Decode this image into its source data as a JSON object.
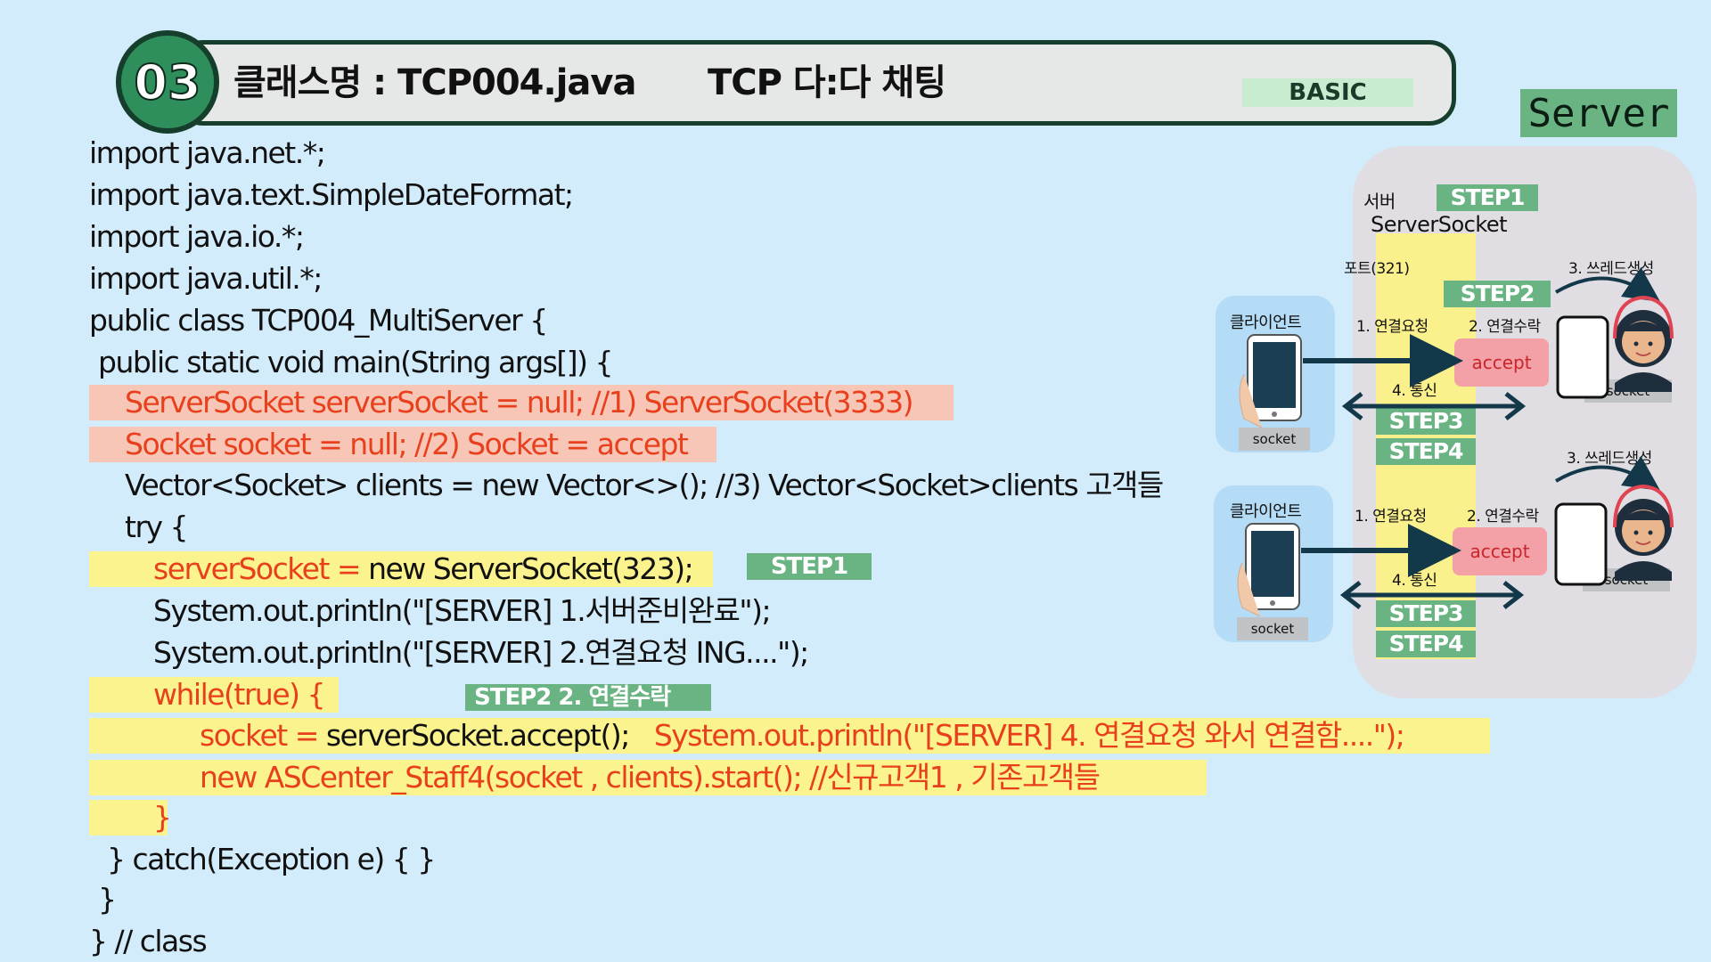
{
  "header": {
    "number": "03",
    "title": "클래스명 : TCP004.java",
    "subtitle": "TCP 다:다 채팅",
    "badge": "BASIC",
    "server_label": "Server"
  },
  "code": {
    "l1": "import java.net.*;",
    "l2": "import java.text.SimpleDateFormat;",
    "l3": "import java.io.*;",
    "l4": "import java.util.*;",
    "l5": "public class TCP004_MultiServer {",
    "l6": "public static void main(String args[]) {",
    "l7": "ServerSocket serverSocket = null; //1) ServerSocket(3333)",
    "l8": "Socket socket = null; //2) Socket = accept",
    "l9": "Vector<Socket> clients = new Vector<>(); //3) Vector<Socket>clients 고객들",
    "l10": "try {",
    "l11a": "serverSocket = ",
    "l11b": "new ServerSocket(323);",
    "l12": "System.out.println(\"[SERVER] 1.서버준비완료\");",
    "l13": "System.out.println(\"[SERVER] 2.연결요청 ING....\");",
    "l14": "while(true) {",
    "l15a": "socket = ",
    "l15b": "serverSocket.accept();",
    "l15c": "System.out.println(\"[SERVER] 4. 연결요청 와서 연결함....\");",
    "l16": "new ASCenter_Staff4(socket , clients).start(); //신규고객1 , 기존고객들",
    "l17": "}",
    "l18": "} catch(Exception e) { }",
    "l19": "}",
    "l20": "} // class",
    "tag_step1": "STEP1",
    "tag_step2": "STEP2   2. 연결수락"
  },
  "diagram": {
    "server_label": "서버",
    "server_socket": "ServerSocket",
    "port": "포트(321)",
    "step1": "STEP1",
    "step2": "STEP2",
    "thread1": "3. 쓰레드생성",
    "thread2": "3. 쓰레드생성",
    "client1": "클라이언트",
    "client2": "클라이언트",
    "req1": "1. 연결요청",
    "req2": "1. 연결요청",
    "accept_req1": "2. 연결수락",
    "accept_req2": "2. 연결수락",
    "accept1": "accept",
    "accept2": "accept",
    "comm1": "4. 통신",
    "comm2": "4. 통신",
    "step3a": "STEP3",
    "step4a": "STEP4",
    "step3b": "STEP3",
    "step4b": "STEP4",
    "socket_c1": "socket",
    "socket_c2": "socket",
    "socket_s1": "socket",
    "socket_s2": "socket",
    "arrow_color": "#12384a"
  }
}
